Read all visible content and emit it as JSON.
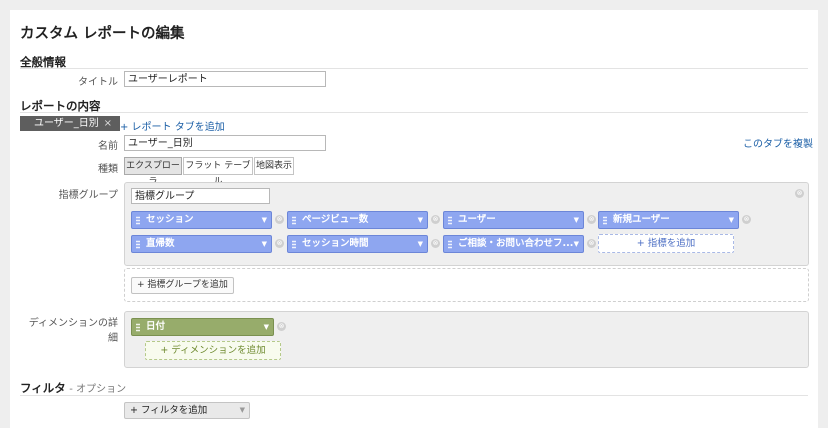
{
  "page": {
    "title": "カスタム レポートの編集"
  },
  "general": {
    "section_title": "全般情報",
    "title_label": "タイトル",
    "title_value": "ユーザーレポート"
  },
  "content": {
    "section_title": "レポートの内容",
    "active_tab": "ユーザー_日別",
    "tab_close": "×",
    "add_tab_label": "+ レポート タブを追加",
    "copy_tab_label": "このタブを複製",
    "name_label": "名前",
    "name_value": "ユーザー_日別",
    "type_label": "種類",
    "types": [
      "エクスプローラ",
      "フラット テーブル",
      "地図表示"
    ],
    "metric_group_label": "指標グループ",
    "metric_group_name": "指標グループ",
    "metrics_row1": [
      "セッション",
      "ページビュー数",
      "ユーザー",
      "新規ユーザー"
    ],
    "metrics_row2": [
      "直帰数",
      "セッション時間",
      "ご相談・お問い合わせフ..."
    ],
    "add_metric_label": "+ 指標を追加",
    "add_metric_group_label": "+ 指標グループを追加",
    "dimension_label": "ディメンションの詳細",
    "dimension_value": "日付",
    "add_dimension_label": "+ ディメンションを追加"
  },
  "filter": {
    "section_title": "フィルタ",
    "option_label": "- オプション",
    "add_filter_label": "+ フィルタを追加"
  },
  "icons": {
    "remove": "⊗",
    "dropdown": "▼",
    "close": "×"
  }
}
